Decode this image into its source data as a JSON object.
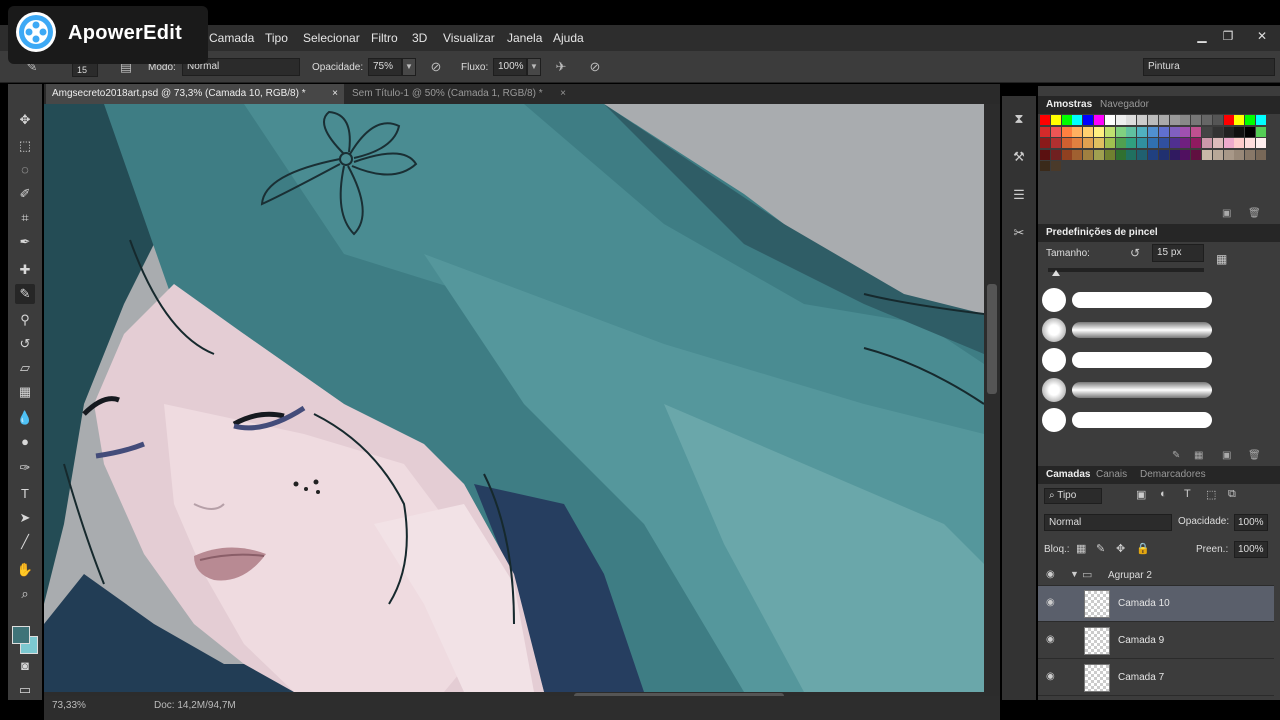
{
  "watermark": {
    "text": "ApowerEdit",
    "icon": "film-reel-icon"
  },
  "menu": {
    "items": [
      "Camada",
      "Tipo",
      "Selecionar",
      "Filtro",
      "3D",
      "Visualizar",
      "Janela",
      "Ajuda"
    ]
  },
  "window_controls": {
    "minimize": "▁",
    "restore": "❐",
    "close": "✕"
  },
  "options_bar": {
    "brush_size": "15",
    "mode_label": "Modo:",
    "mode_value": "Normal",
    "opacity_label": "Opacidade:",
    "opacity_value": "75%",
    "flow_label": "Fluxo:",
    "flow_value": "100%",
    "workspace": "Pintura"
  },
  "tabs": [
    {
      "label": "Amgsecreto2018art.psd @ 73,3% (Camada 10, RGB/8) *",
      "close": "×",
      "active": true
    },
    {
      "label": "Sem Título-1 @ 50% (Camada 1, RGB/8) *",
      "close": "×",
      "active": false
    }
  ],
  "status": {
    "zoom": "73,33%",
    "doc": "Doc: 14,2M/94,7M"
  },
  "swatches_panel": {
    "tabs": [
      "Amostras",
      "Navegador"
    ]
  },
  "brush_panel": {
    "title": "Predefinições de pincel",
    "size_label": "Tamanho:",
    "size_value": "15 px"
  },
  "layers_panel": {
    "tabs": [
      "Camadas",
      "Canais",
      "Demarcadores"
    ],
    "filter": "Tipo",
    "blend_mode": "Normal",
    "opacity_label": "Opacidade:",
    "opacity_value": "100%",
    "lock_label": "Bloq.:",
    "fill_label": "Preen.:",
    "fill_value": "100%",
    "group_name": "Agrupar 2",
    "layers": [
      {
        "name": "Camada 10",
        "selected": true
      },
      {
        "name": "Camada 9",
        "selected": false
      },
      {
        "name": "Camada 7",
        "selected": false
      }
    ]
  },
  "colors": {
    "foreground": "#3f7378",
    "background": "#7cc8d0",
    "hair": "#3f7d82",
    "skin": "#e7cfd6"
  }
}
